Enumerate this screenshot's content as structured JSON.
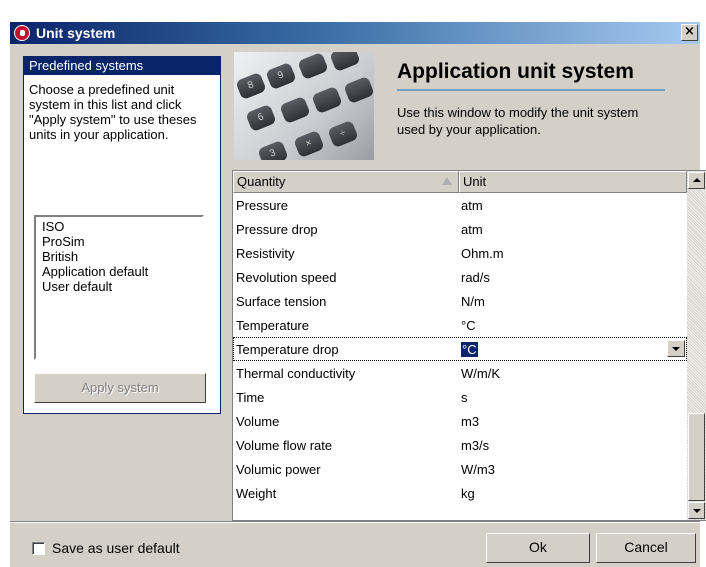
{
  "window": {
    "title": "Unit system",
    "close": "×"
  },
  "predefined": {
    "title": "Predefined systems",
    "description": "Choose a predefined unit system in this list and click \"Apply system\" to use theses units in your application.",
    "systems": [
      "ISO",
      "ProSim",
      "British",
      "Application default",
      "User default"
    ],
    "apply_label": "Apply system"
  },
  "header": {
    "title": "Application unit system",
    "description": "Use this window to modify the unit system used by your application."
  },
  "photo_keys": [
    "8",
    "9",
    "6",
    "×",
    "÷",
    "3"
  ],
  "grid": {
    "columns": [
      "Quantity",
      "Unit"
    ],
    "rows": [
      {
        "quantity": "Pressure",
        "unit": "atm"
      },
      {
        "quantity": "Pressure drop",
        "unit": "atm"
      },
      {
        "quantity": "Resistivity",
        "unit": "Ohm.m"
      },
      {
        "quantity": "Revolution speed",
        "unit": "rad/s"
      },
      {
        "quantity": "Surface tension",
        "unit": "N/m"
      },
      {
        "quantity": "Temperature",
        "unit": "°C"
      },
      {
        "quantity": "Temperature drop",
        "unit": "°C"
      },
      {
        "quantity": "Thermal conductivity",
        "unit": "W/m/K"
      },
      {
        "quantity": "Time",
        "unit": "s"
      },
      {
        "quantity": "Volume",
        "unit": "m3"
      },
      {
        "quantity": "Volume flow rate",
        "unit": "m3/s"
      },
      {
        "quantity": "Volumic power",
        "unit": "W/m3"
      },
      {
        "quantity": "Weight",
        "unit": "kg"
      }
    ],
    "selected_index": 6
  },
  "footer": {
    "save_default_label": "Save as user default",
    "save_default_checked": false,
    "ok_label": "Ok",
    "cancel_label": "Cancel"
  }
}
